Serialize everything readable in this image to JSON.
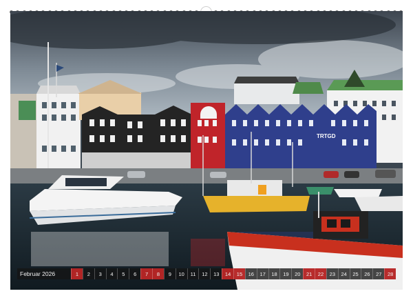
{
  "calendar": {
    "month_label": "Februar",
    "year_label": "2026",
    "days": [
      "1",
      "2",
      "3",
      "4",
      "5",
      "6",
      "7",
      "8",
      "9",
      "10",
      "11",
      "12",
      "13",
      "14",
      "15",
      "16",
      "17",
      "18",
      "19",
      "20",
      "21",
      "22",
      "23",
      "24",
      "25",
      "26",
      "27",
      "28"
    ],
    "weekend_days": [
      "1",
      "7",
      "8",
      "14",
      "15",
      "21",
      "22",
      "28"
    ]
  },
  "photo": {
    "boat_name": "TRTGD",
    "subject": "harbour-town"
  },
  "colors": {
    "sky": "#6b7884",
    "red_house": "#c0242a",
    "blue_house": "#2f3f8c",
    "black_house": "#252525",
    "water": "#1c2a33",
    "weekend": "#cd2828"
  }
}
